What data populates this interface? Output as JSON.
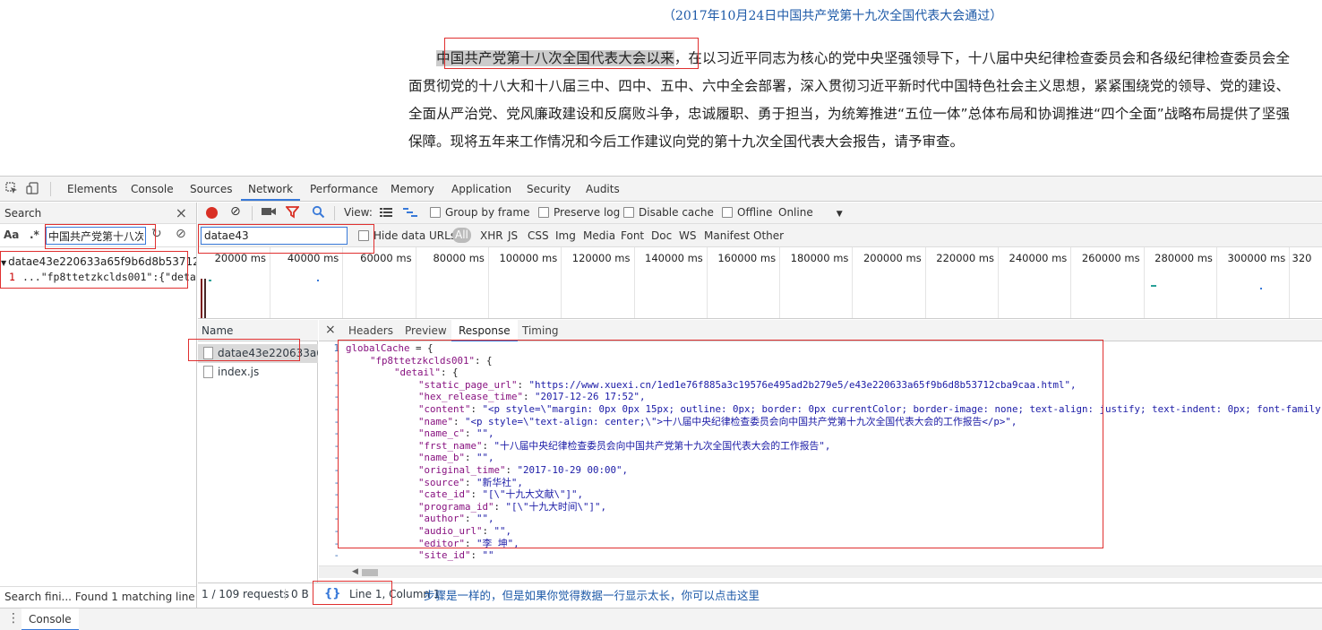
{
  "article": {
    "caption": "（2017年10月24日中国共产党第十九次全国代表大会通过）",
    "highlight": "中国共产党第十八次全国代表大会以来",
    "rest": "，在以习近平同志为核心的党中央坚强领导下，十八届中央纪律检查委员会和各级纪律检查委员会全面贯彻党的十八大和十八届三中、四中、五中、六中全会部署，深入贯彻习近平新时代中国特色社会主义思想，紧紧围绕党的领导、党的建设、全面从严治党、党风廉政建设和反腐败斗争，忠诚履职、勇于担当，为统筹推进“五位一体”总体布局和协调推进“四个全面”战略布局提供了坚强保障。现将五年来工作情况和今后工作建议向党的第十九次全国代表大会报告，请予审查。"
  },
  "devtools": {
    "tabs": [
      "Elements",
      "Console",
      "Sources",
      "Network",
      "Performance",
      "Memory",
      "Application",
      "Security",
      "Audits"
    ],
    "active_tab": "Network"
  },
  "search": {
    "title": "Search",
    "case_label": "Aa",
    "regex_label": ".*",
    "query": "中国共产党第十八次",
    "result_file": "datae43e220633a65f9b6d8b53712cb...",
    "result_line_no": "1",
    "result_line_text": "...\"fp8ttetzkclds001\":{\"detail\":{\"stat...",
    "status": "Search fini...   Found 1 matching line i..."
  },
  "network": {
    "view_label": "View:",
    "group_by_frame": "Group by frame",
    "preserve_log": "Preserve log",
    "disable_cache": "Disable cache",
    "offline": "Offline",
    "throttle": "Online",
    "filter_value": "datae43",
    "hide_data_urls": "Hide data URLs",
    "filters": [
      "All",
      "XHR",
      "JS",
      "CSS",
      "Img",
      "Media",
      "Font",
      "Doc",
      "WS",
      "Manifest",
      "Other"
    ],
    "ticks": [
      "20000 ms",
      "40000 ms",
      "60000 ms",
      "80000 ms",
      "100000 ms",
      "120000 ms",
      "140000 ms",
      "160000 ms",
      "180000 ms",
      "200000 ms",
      "220000 ms",
      "240000 ms",
      "260000 ms",
      "280000 ms",
      "300000 ms",
      "320"
    ],
    "name_header": "Name",
    "requests": [
      "datae43e220633a65f9b6d8b53712cb9caa.js",
      "index.js"
    ],
    "detail_tabs": [
      "Headers",
      "Preview",
      "Response",
      "Timing"
    ],
    "active_detail_tab": "Response",
    "status_requests": "1 / 109 requests",
    "status_size": "0 B",
    "pretty_print": "{}",
    "cursor": "Line 1, Column 1",
    "annotation": "步骤是一样的，但是如果你觉得数据一行显示太长，你可以点击这里"
  },
  "response_lines": [
    {
      "gutter": "1",
      "indent": 0,
      "key": "globalCache",
      "sep": " = ",
      "value": "{",
      "vtype": "p"
    },
    {
      "gutter": "-",
      "indent": 1,
      "key": "\"fp8ttetzkclds001\"",
      "sep": ": ",
      "value": "{",
      "vtype": "p"
    },
    {
      "gutter": "-",
      "indent": 2,
      "key": "\"detail\"",
      "sep": ": ",
      "value": "{",
      "vtype": "p"
    },
    {
      "gutter": "-",
      "indent": 3,
      "key": "\"static_page_url\"",
      "sep": ": ",
      "value": "\"https://www.xuexi.cn/1ed1e76f885a3c19576e495ad2b279e5/e43e220633a65f9b6d8b53712cba9caa.html\",",
      "vtype": "s"
    },
    {
      "gutter": "-",
      "indent": 3,
      "key": "\"hex_release_time\"",
      "sep": ": ",
      "value": "\"2017-12-26 17:52\",",
      "vtype": "s"
    },
    {
      "gutter": "-",
      "indent": 3,
      "key": "\"content\"",
      "sep": ": ",
      "value": "\"<p style=\\\"margin: 0px 0px 15px; outline: 0px; border: 0px currentColor; border-image: none; text-align: justify; text-indent: 0px; font-family",
      "vtype": "s"
    },
    {
      "gutter": "-",
      "indent": 3,
      "key": "\"name\"",
      "sep": ": ",
      "value": "\"<p style=\\\"text-align: center;\\\">十八届中央纪律检查委员会向中国共产党第十九次全国代表大会的工作报告</p>\",",
      "vtype": "s"
    },
    {
      "gutter": "-",
      "indent": 3,
      "key": "\"name_c\"",
      "sep": ": ",
      "value": "\"\",",
      "vtype": "s"
    },
    {
      "gutter": "-",
      "indent": 3,
      "key": "\"frst_name\"",
      "sep": ": ",
      "value": "\"十八届中央纪律检查委员会向中国共产党第十九次全国代表大会的工作报告\",",
      "vtype": "s"
    },
    {
      "gutter": "-",
      "indent": 3,
      "key": "\"name_b\"",
      "sep": ": ",
      "value": "\"\",",
      "vtype": "s"
    },
    {
      "gutter": "-",
      "indent": 3,
      "key": "\"original_time\"",
      "sep": ": ",
      "value": "\"2017-10-29 00:00\",",
      "vtype": "s"
    },
    {
      "gutter": "-",
      "indent": 3,
      "key": "\"source\"",
      "sep": ": ",
      "value": "\"新华社\",",
      "vtype": "s"
    },
    {
      "gutter": "-",
      "indent": 3,
      "key": "\"cate_id\"",
      "sep": ": ",
      "value": "\"[\\\"十九大文献\\\"]\",",
      "vtype": "s"
    },
    {
      "gutter": "-",
      "indent": 3,
      "key": "\"programa_id\"",
      "sep": ": ",
      "value": "\"[\\\"十九大时间\\\"]\",",
      "vtype": "s"
    },
    {
      "gutter": "-",
      "indent": 3,
      "key": "\"author\"",
      "sep": ": ",
      "value": "\"\",",
      "vtype": "s"
    },
    {
      "gutter": "-",
      "indent": 3,
      "key": "\"audio_url\"",
      "sep": ": ",
      "value": "\"\",",
      "vtype": "s"
    },
    {
      "gutter": "-",
      "indent": 3,
      "key": "\"editor\"",
      "sep": ": ",
      "value": "\"李 坤\",",
      "vtype": "s"
    },
    {
      "gutter": "-",
      "indent": 3,
      "key": "\"site_id\"",
      "sep": ": ",
      "value": "\"\"",
      "vtype": "s"
    }
  ]
}
